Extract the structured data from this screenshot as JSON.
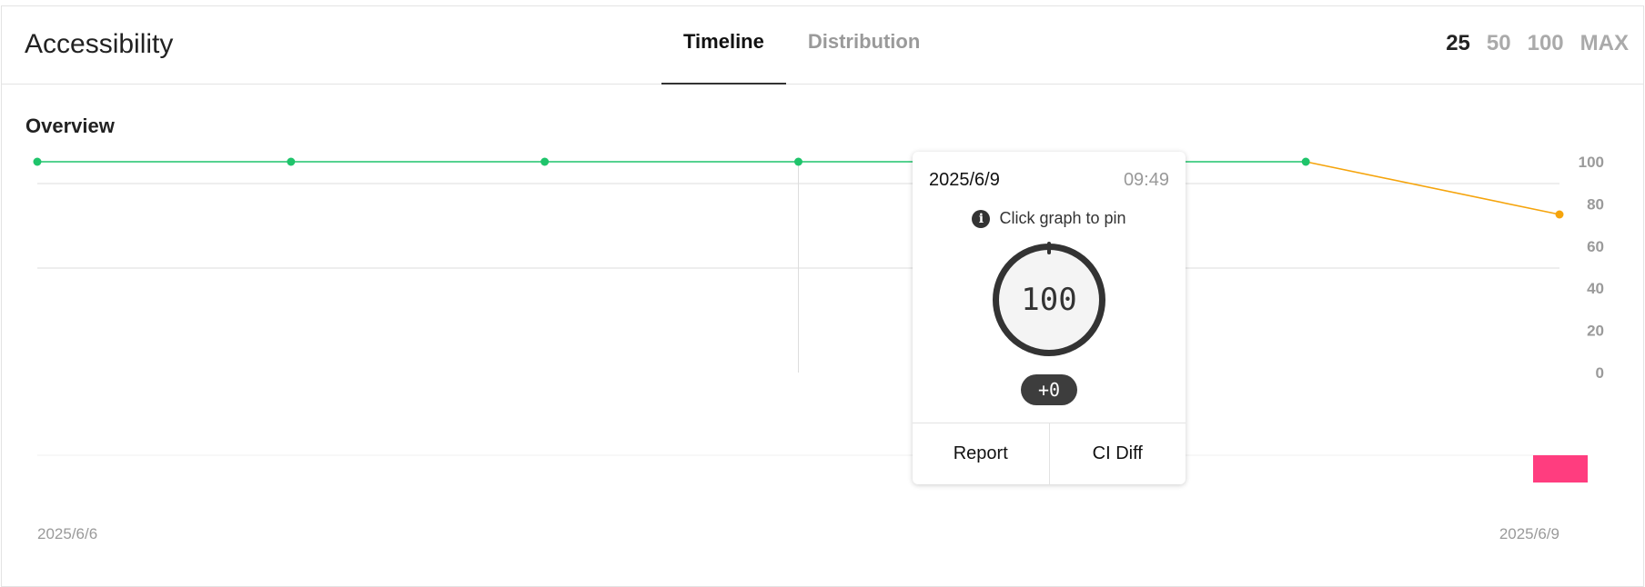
{
  "header": {
    "title": "Accessibility",
    "tabs": [
      {
        "label": "Timeline",
        "active": true
      },
      {
        "label": "Distribution",
        "active": false
      }
    ],
    "ranges": [
      {
        "label": "25",
        "active": true
      },
      {
        "label": "50",
        "active": false
      },
      {
        "label": "100",
        "active": false
      },
      {
        "label": "MAX",
        "active": false
      }
    ]
  },
  "section": {
    "title": "Overview"
  },
  "chart_data": {
    "type": "line",
    "x_start_label": "2025/6/6",
    "x_end_label": "2025/6/9",
    "values": [
      100,
      100,
      100,
      100,
      100,
      100,
      75
    ],
    "ylim": [
      0,
      100
    ],
    "yticks": [
      "100",
      "80",
      "60",
      "40",
      "20",
      "0"
    ],
    "colors": {
      "pass": "#1fc46b",
      "average": "#f5a40c",
      "fail": "#ff3d7f"
    }
  },
  "tooltip": {
    "date": "2025/6/9",
    "time": "09:49",
    "hint": "Click graph to pin",
    "score": "100",
    "delta": "+0",
    "report_label": "Report",
    "ci_diff_label": "CI Diff"
  }
}
